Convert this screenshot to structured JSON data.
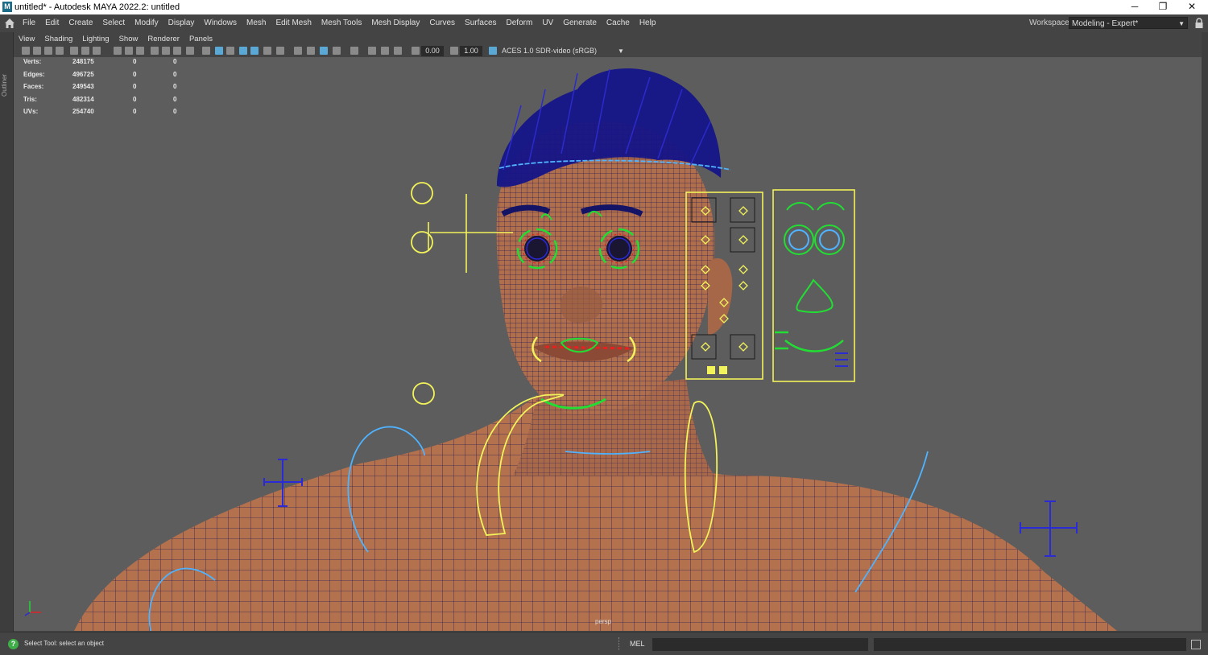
{
  "window": {
    "title": "untitled* - Autodesk MAYA 2022.2: untitled",
    "app_icon_letter": "M",
    "minimize": "─",
    "restore": "❐",
    "close": "✕"
  },
  "menubar": {
    "items": [
      "File",
      "Edit",
      "Create",
      "Select",
      "Modify",
      "Display",
      "Windows",
      "Mesh",
      "Edit Mesh",
      "Mesh Tools",
      "Mesh Display",
      "Curves",
      "Surfaces",
      "Deform",
      "UV",
      "Generate",
      "Cache",
      "Help"
    ],
    "workspace_label": "Workspace:",
    "workspace_value": "Modeling - Expert*"
  },
  "left_strip": {
    "outliner_label": "Outliner"
  },
  "panel_menu": {
    "items": [
      "View",
      "Shading",
      "Lighting",
      "Show",
      "Renderer",
      "Panels"
    ]
  },
  "panel_toolbar": {
    "exposure": "0.00",
    "gamma": "1.00",
    "color_space": "ACES 1.0 SDR-video (sRGB)"
  },
  "hud": {
    "rows": [
      {
        "label": "Verts:",
        "v1": "248175",
        "v2": "0",
        "v3": "0"
      },
      {
        "label": "Edges:",
        "v1": "496725",
        "v2": "0",
        "v3": "0"
      },
      {
        "label": "Faces:",
        "v1": "249543",
        "v2": "0",
        "v3": "0"
      },
      {
        "label": "Tris:",
        "v1": "482314",
        "v2": "0",
        "v3": "0"
      },
      {
        "label": "UVs:",
        "v1": "254740",
        "v2": "0",
        "v3": "0"
      }
    ]
  },
  "viewport": {
    "camera": "persp",
    "colors": {
      "background": "#5d5d5d",
      "skin": "#b06f4c",
      "wire": "#1a1a66",
      "control_yellow": "#f2f25a",
      "control_green": "#22dd33",
      "control_blue": "#2a2ad6",
      "control_lightblue": "#4fb3ff",
      "control_red": "#e82020"
    }
  },
  "statusbar": {
    "help_text": "Select Tool: select an object",
    "mel_label": "MEL"
  }
}
